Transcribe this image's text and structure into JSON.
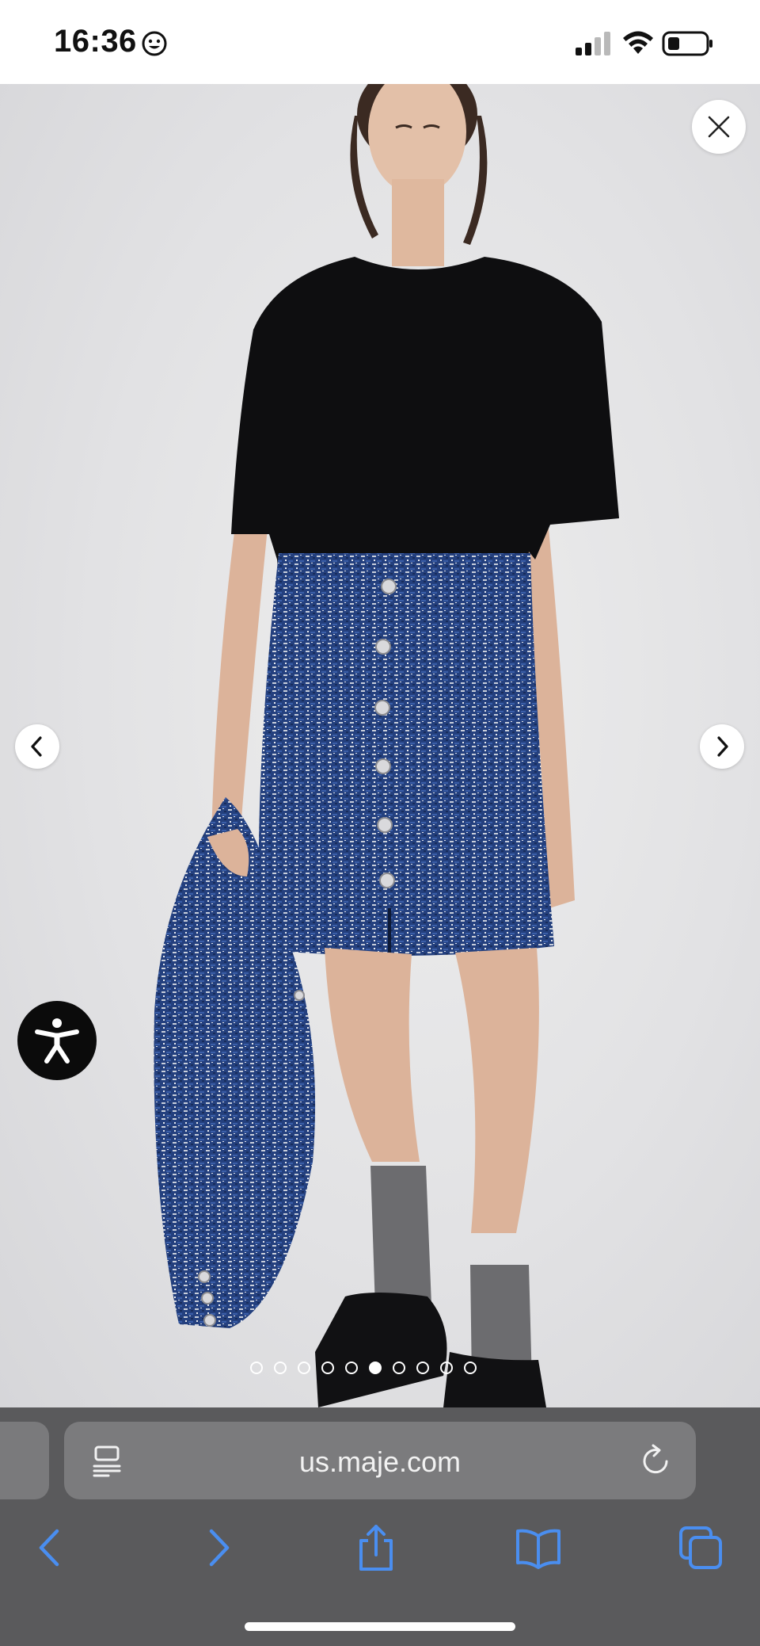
{
  "status_bar": {
    "time": "16:36",
    "status_icon": "smiley-face-icon",
    "signal_icon": "cellular-signal-icon",
    "wifi_icon": "wifi-icon",
    "battery_icon": "battery-icon"
  },
  "viewer": {
    "image_description_icon": "product-photo",
    "close_icon": "close-icon",
    "prev_icon": "chevron-left-icon",
    "next_icon": "chevron-right-icon",
    "accessibility_icon": "accessibility-person-icon",
    "pagination": {
      "total": 10,
      "active_index": 5
    }
  },
  "browser": {
    "url": "us.maje.com",
    "reader_icon": "page-menu-icon",
    "reload_icon": "reload-icon",
    "toolbar": [
      "back-icon",
      "forward-icon",
      "share-icon",
      "bookmarks-icon",
      "tabs-icon"
    ]
  },
  "colors": {
    "accent": "#4a8ef0",
    "toolbar_bg": "#5a5a5c",
    "url_bar_bg": "#7b7b7d"
  }
}
